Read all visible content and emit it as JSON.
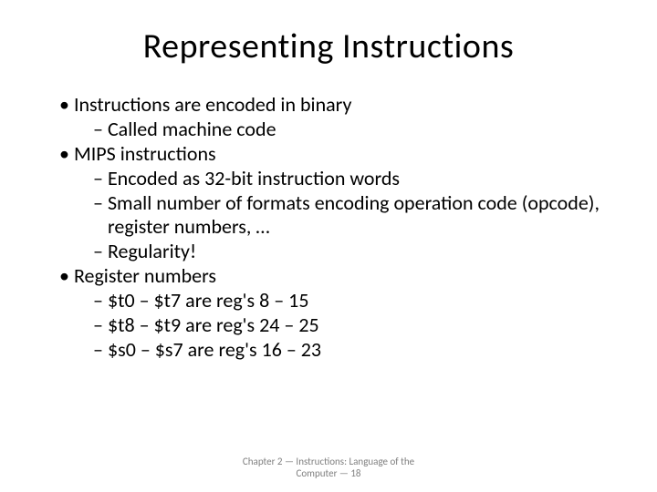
{
  "title": "Representing Instructions",
  "bullets": {
    "b1": "Instructions are encoded in binary",
    "b1_1": "Called machine code",
    "b2": "MIPS instructions",
    "b2_1": "Encoded as 32-bit instruction words",
    "b2_2": "Small number of formats encoding operation code (opcode), register numbers, …",
    "b2_3": "Regularity!",
    "b3": "Register numbers",
    "b3_1": "$t0 – $t7 are reg's 8 – 15",
    "b3_2": "$t8 – $t9 are reg's 24 – 25",
    "b3_3": "$s0 – $s7 are reg's 16 – 23"
  },
  "footer": {
    "line1": "Chapter 2 — Instructions: Language of the",
    "line2": "Computer — 18"
  }
}
